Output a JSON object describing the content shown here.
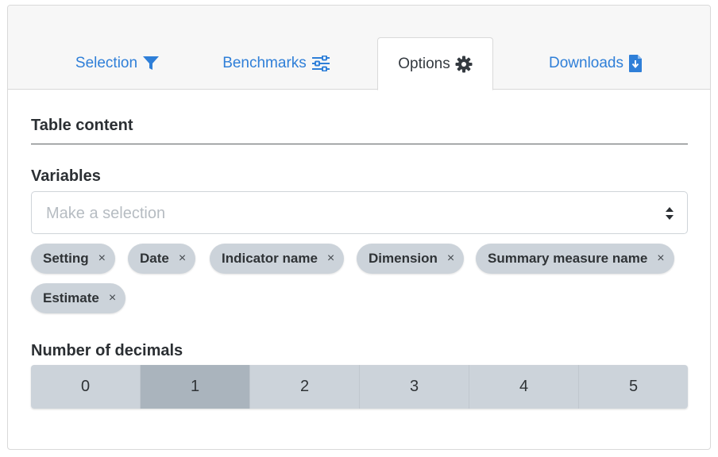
{
  "tabs": [
    {
      "label": "Selection",
      "icon": "filter-icon",
      "active": false
    },
    {
      "label": "Benchmarks",
      "icon": "sliders-icon",
      "active": false
    },
    {
      "label": "Options",
      "icon": "gear-icon",
      "active": true
    },
    {
      "label": "Downloads",
      "icon": "file-download-icon",
      "active": false
    }
  ],
  "section": {
    "title": "Table content"
  },
  "variables": {
    "label": "Variables",
    "placeholder": "Make a selection",
    "chips": [
      "Setting",
      "Date",
      "Indicator name",
      "Dimension",
      "Summary measure name",
      "Estimate"
    ],
    "remove_glyph": "×"
  },
  "decimals": {
    "label": "Number of decimals",
    "options": [
      "0",
      "1",
      "2",
      "3",
      "4",
      "5"
    ],
    "selected": "1"
  },
  "colors": {
    "link": "#2f7fd8",
    "chip_bg": "#ccd3da",
    "selected_bg": "#aab4bd"
  }
}
